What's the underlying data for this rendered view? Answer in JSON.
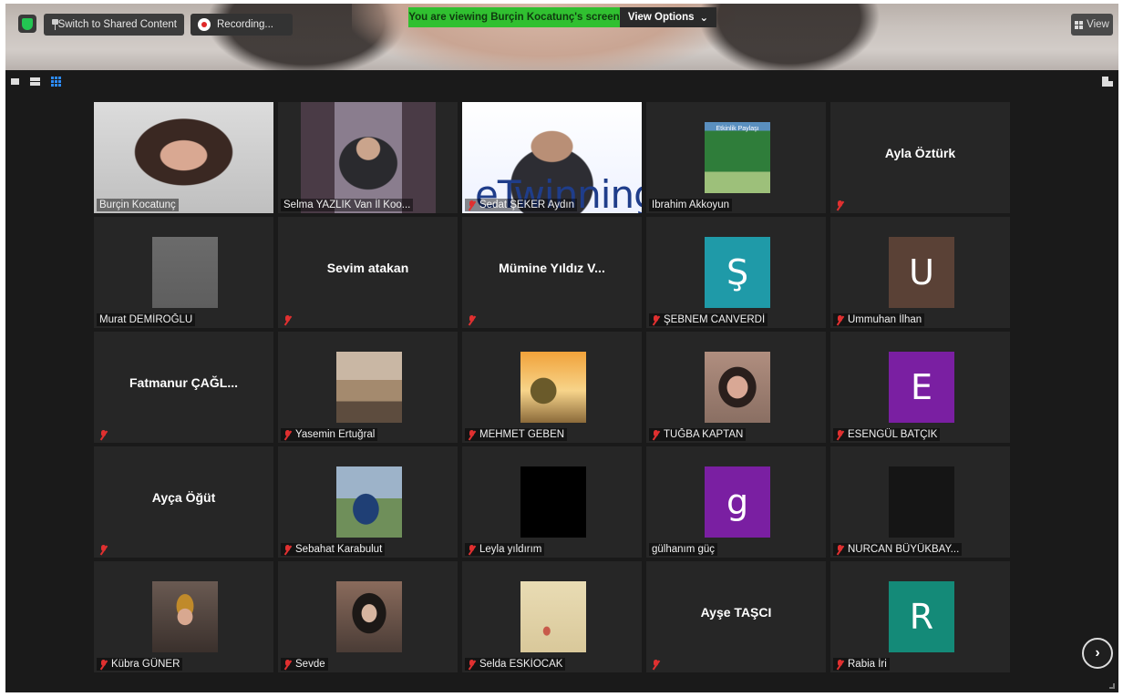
{
  "top": {
    "switch_label": "Switch to Shared Content",
    "recording_label": "Recording...",
    "viewing_prefix": "You are viewing ",
    "viewing_name": "Burçin Kocatunç",
    "viewing_suffix": "'s screen",
    "view_options_label": "View Options",
    "view_label": "View"
  },
  "participants": [
    {
      "name": "Burçin Kocatunç",
      "muted": false,
      "kind": "video",
      "active": true
    },
    {
      "name": "Selma YAZLIK Van İl Koo...",
      "muted": false,
      "kind": "video"
    },
    {
      "name": "Sedat ŞEKER Aydın",
      "muted": true,
      "kind": "video",
      "overlay_text": "eTwinning"
    },
    {
      "name": "Ibrahim Akkoyun",
      "muted": false,
      "kind": "photo",
      "photo_caption": "Etkinlik Paylaşı"
    },
    {
      "name": "",
      "muted": true,
      "kind": "text",
      "display": "Ayla Öztürk"
    },
    {
      "name": "Murat DEMİROĞLU",
      "muted": false,
      "kind": "photo"
    },
    {
      "name": "",
      "muted": true,
      "kind": "text",
      "display": "Sevim atakan"
    },
    {
      "name": "",
      "muted": true,
      "kind": "text",
      "display": "Mümine Yıldız V..."
    },
    {
      "name": "ŞEBNEM CANVERDİ",
      "muted": true,
      "kind": "avatar",
      "letter": "Ş",
      "color": "#1f9aa8"
    },
    {
      "name": "Ummuhan İlhan",
      "muted": true,
      "kind": "avatar",
      "letter": "U",
      "color": "#5a4136"
    },
    {
      "name": "",
      "muted": true,
      "kind": "text",
      "display": "Fatmanur ÇAĞL..."
    },
    {
      "name": "Yasemin Ertuğral",
      "muted": true,
      "kind": "photo"
    },
    {
      "name": "MEHMET GEBEN",
      "muted": true,
      "kind": "photo"
    },
    {
      "name": "TUĞBA KAPTAN",
      "muted": true,
      "kind": "photo"
    },
    {
      "name": "ESENGÜL BATÇIK",
      "muted": true,
      "kind": "avatar",
      "letter": "E",
      "color": "#7a1fa2"
    },
    {
      "name": "",
      "muted": true,
      "kind": "text",
      "display": "Ayça Öğüt"
    },
    {
      "name": "Sebahat Karabulut",
      "muted": true,
      "kind": "photo"
    },
    {
      "name": "Leyla yıldırım",
      "muted": true,
      "kind": "photo"
    },
    {
      "name": "gülhanım güç",
      "muted": false,
      "kind": "avatar",
      "letter": "g",
      "color": "#7a1fa2"
    },
    {
      "name": "NURCAN BÜYÜKBAY...",
      "muted": true,
      "kind": "photo"
    },
    {
      "name": "Kübra GÜNER",
      "muted": true,
      "kind": "photo"
    },
    {
      "name": "Sevde",
      "muted": true,
      "kind": "photo"
    },
    {
      "name": "Selda ESKİOCAK",
      "muted": true,
      "kind": "photo"
    },
    {
      "name": "",
      "muted": true,
      "kind": "text",
      "display": "Ayşe TAŞCI"
    },
    {
      "name": "Rabia İri",
      "muted": true,
      "kind": "avatar",
      "letter": "R",
      "color": "#148a78"
    }
  ],
  "next_page_icon": "chevron-right-icon"
}
